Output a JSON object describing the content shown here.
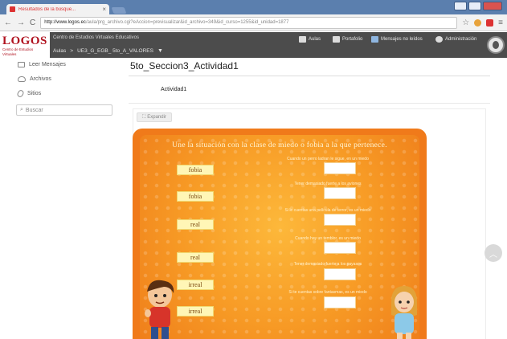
{
  "browser": {
    "tab_title": "Resultados de la búsque...",
    "tab_close": "×",
    "url_host": "http://www.logos.ec",
    "url_rest": "/aula/prg_archivo.cgi?eAccion=previsualizar&id_archivo=349&id_curso=1255&id_unidad=1877",
    "back": "←",
    "forward": "→",
    "reload": "C",
    "star": "☆",
    "menu": "≡"
  },
  "site": {
    "logo_text": "LOGOS",
    "logo_sub": "Centro de Estudios Virtuales",
    "center_name": "Centro de Estudios Virtuales Educativos",
    "crumb_aulas": "Aulas",
    "crumb_sep": ">",
    "crumb_course": "UE3_G_EGB_ 5to_A_VALORES",
    "crumb_caret": "▼",
    "nav": {
      "aulas": "Aulas",
      "portafolio": "Portafolio",
      "mensajes": "Mensajes no leídos",
      "admin": "Administración"
    }
  },
  "sidebar": {
    "items": [
      {
        "label": "Leer Mensajes"
      },
      {
        "label": "Archivos"
      },
      {
        "label": "Sitios"
      }
    ],
    "search_placeholder": "Buscar"
  },
  "main": {
    "page_title": "5to_Seccion3_Actividad1",
    "activity_label": "Actividad1",
    "expand_label": "Expandir"
  },
  "game": {
    "instruction": "Une la situación con la clase de miedo o fobia a la que pertenece.",
    "answers": [
      "fobia",
      "fobia",
      "real",
      "real",
      "irreal",
      "irreal"
    ],
    "prompts": [
      "Cuando un perro ladran le sigue, en un miedo",
      "Tener demasiado fuerte a los aviones",
      "Si le cuentas una película de terror, es un miedo",
      "Cuando hay un temblor, es un miedo",
      "Tener demasiado fuerte a los payasos",
      "Si te cuentas sobre fantasmas, es un miedo"
    ]
  },
  "colors": {
    "game_border": "#f07a1a",
    "answer_bg": "#fff6b6",
    "header_bg": "#4c4c4c",
    "logo_red": "#b0121f"
  }
}
